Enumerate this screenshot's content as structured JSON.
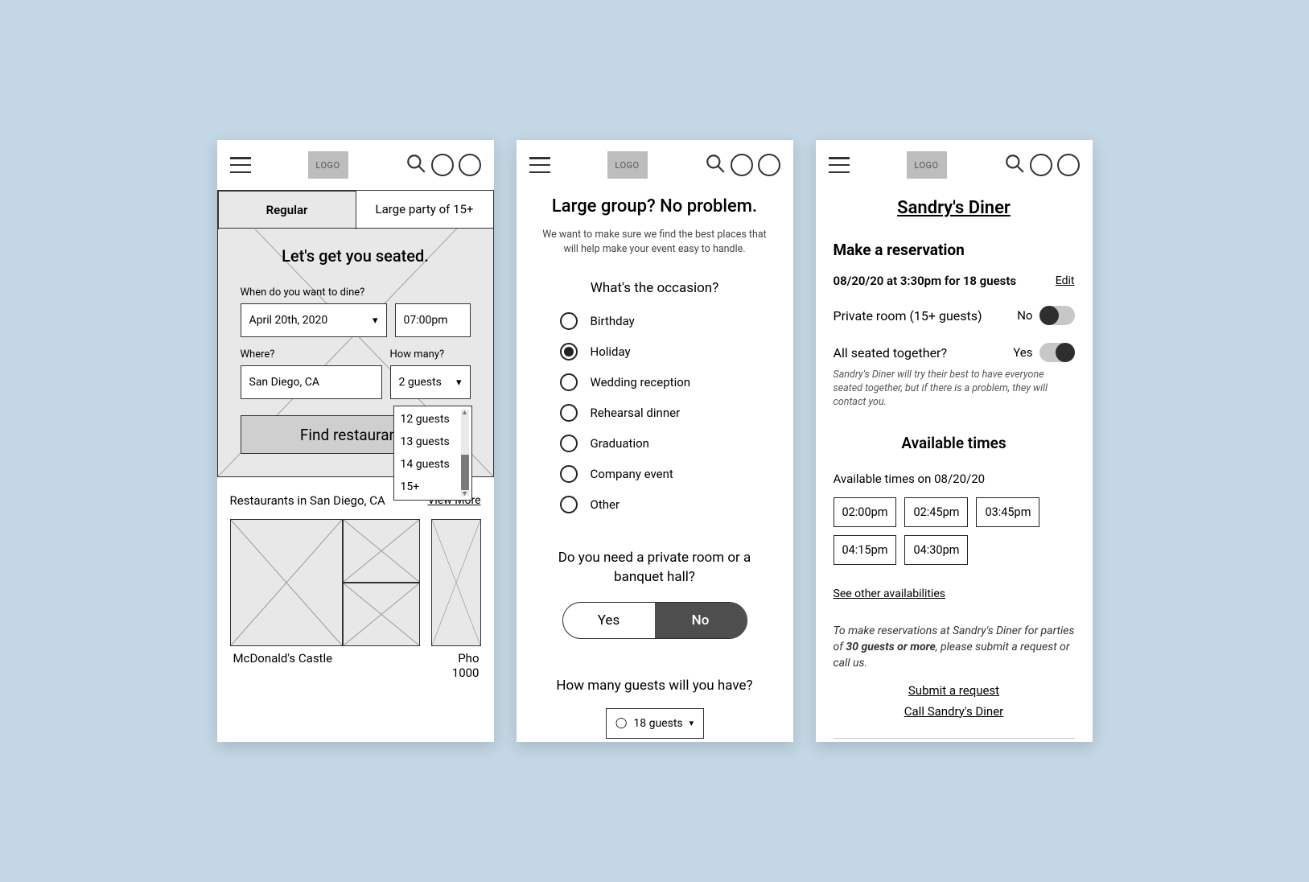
{
  "header": {
    "logo": "LOGO"
  },
  "screen1": {
    "tabs": {
      "regular": "Regular",
      "large": "Large party of 15+"
    },
    "title": "Let's get you seated.",
    "when_label": "When do you want to dine?",
    "date_value": "April 20th, 2020",
    "time_value": "07:00pm",
    "where_label": "Where?",
    "where_value": "San Diego, CA",
    "howmany_label": "How many?",
    "howmany_value": "2 guests",
    "find_label": "Find restaurants",
    "guests_dropdown": [
      "12 guests",
      "13 guests",
      "14 guests",
      "15+"
    ],
    "results_heading": "Restaurants in San Diego, CA",
    "view_more": "View More",
    "restaurant1": "McDonald's Castle",
    "restaurant2": "Pho 1000"
  },
  "screen2": {
    "title": "Large group? No problem.",
    "subtitle": "We want to make sure we find the best places that will help make your event easy to handle.",
    "occasion_q": "What's the occasion?",
    "options": [
      "Birthday",
      "Holiday",
      "Wedding reception",
      "Rehearsal dinner",
      "Graduation",
      "Company event",
      "Other"
    ],
    "selected_option": "Holiday",
    "private_q": "Do you need a private room or a banquet hall?",
    "yes": "Yes",
    "no": "No",
    "private_selected": "No",
    "howmany_q": "How many guests will you have?",
    "guest_value": "18 guests"
  },
  "screen3": {
    "title": "Sandry's Diner",
    "heading": "Make a reservation",
    "summary": "08/20/20 at 3:30pm for 18 guests",
    "edit": "Edit",
    "private_room_label": "Private room (15+ guests)",
    "private_room_value": "No",
    "seated_label": "All seated together?",
    "seated_value": "Yes",
    "seated_note": "Sandry's Diner will try their best to have everyone seated together, but if there is a problem, they will contact you.",
    "available_h": "Available times",
    "available_sub": "Available times on 08/20/20",
    "times": [
      "02:00pm",
      "02:45pm",
      "03:45pm",
      "04:15pm",
      "04:30pm"
    ],
    "see_other": "See other availabilities",
    "request_note_pre": "To make reservations at Sandry's Diner for parties of ",
    "request_note_bold": "30 guests or more",
    "request_note_post": ", please submit a request or call us.",
    "submit_link": "Submit a request",
    "call_link": "Call Sandry's Diner"
  }
}
